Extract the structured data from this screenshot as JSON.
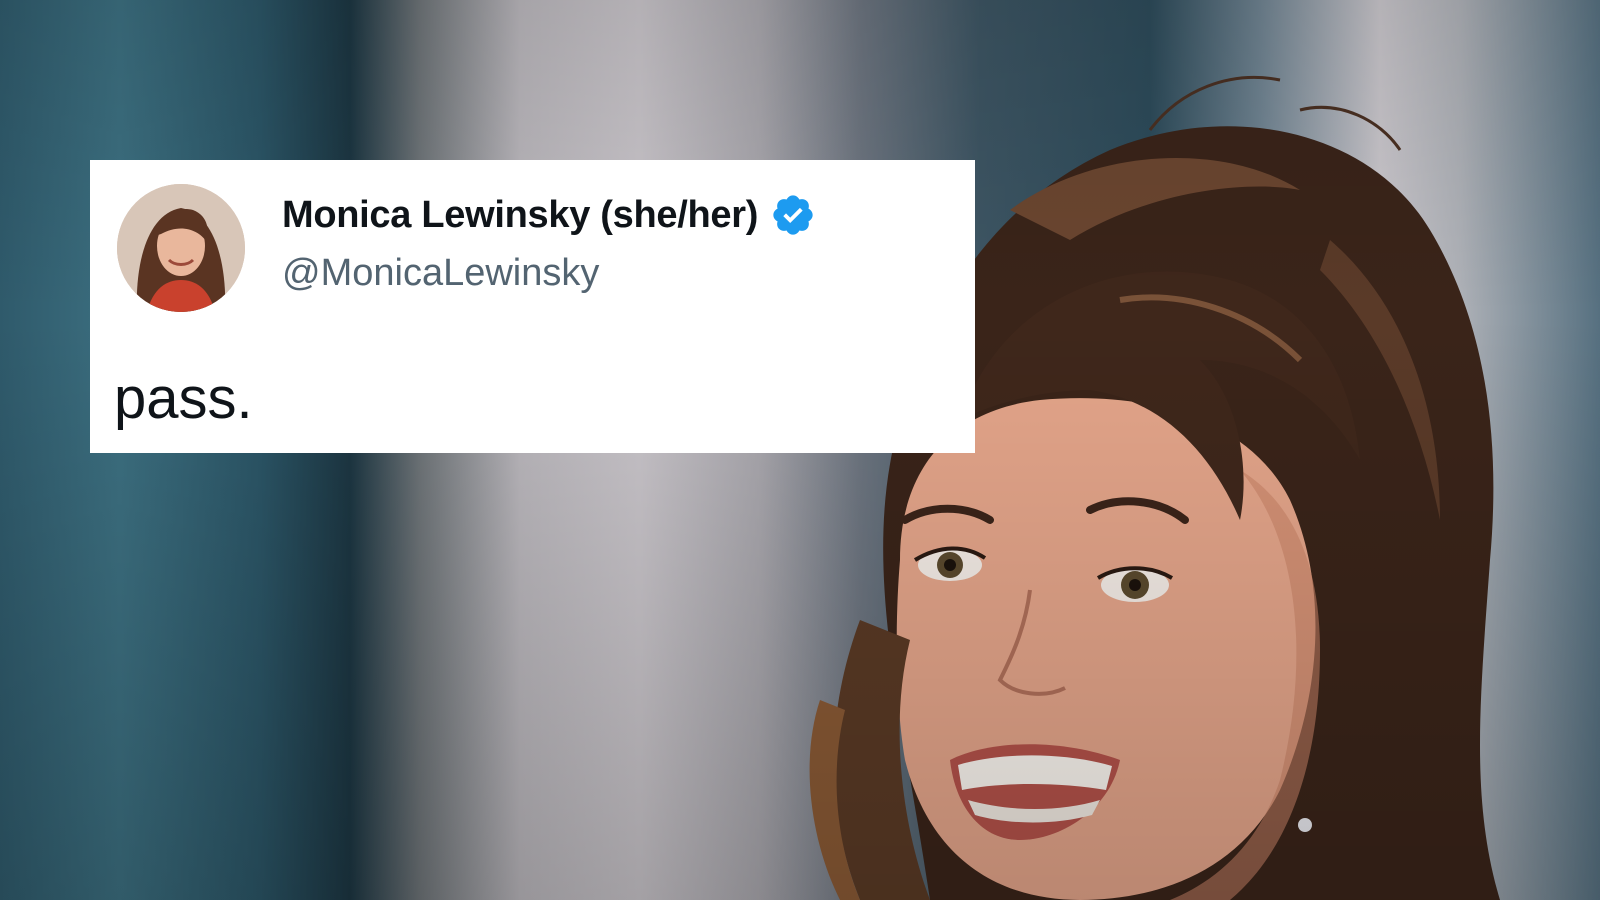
{
  "tweet": {
    "display_name": "Monica Lewinsky (she/her)",
    "handle": "@MonicaLewinsky",
    "text": "pass.",
    "verified": true
  },
  "colors": {
    "verified_badge": "#1d9bf0",
    "name": "#0f1419",
    "handle": "#536471",
    "card_background": "#ffffff"
  },
  "icons": {
    "verified": "verified-badge-icon",
    "avatar": "profile-avatar"
  }
}
